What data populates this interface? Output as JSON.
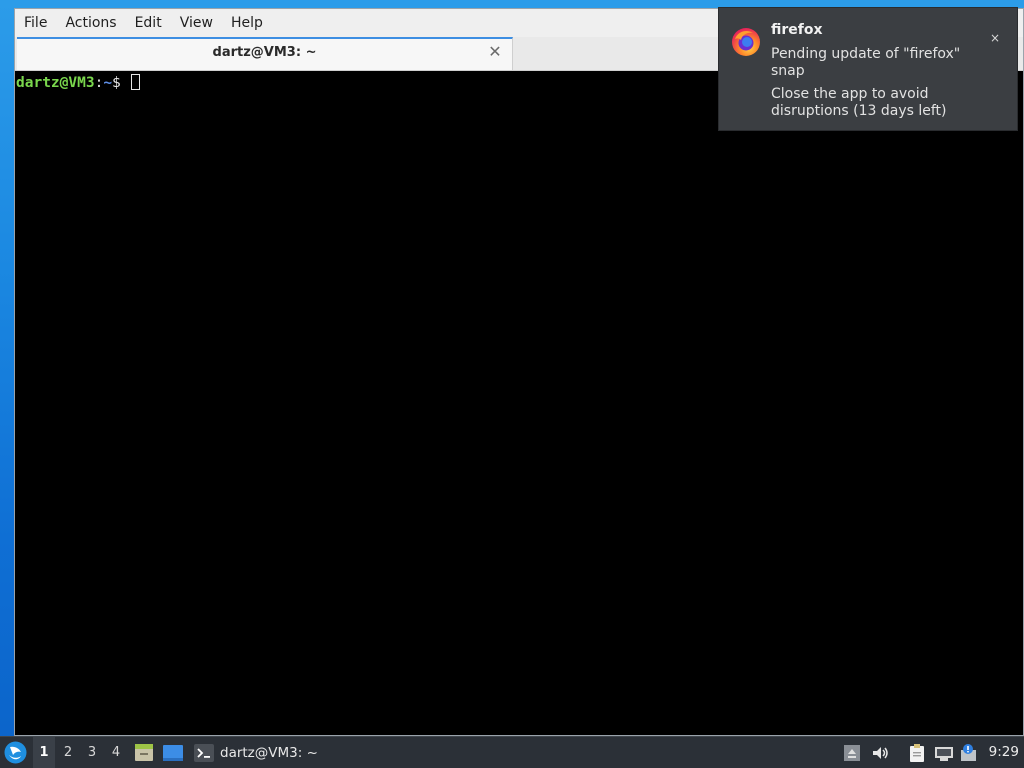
{
  "colors": {
    "desktop_top": "#2c9ce9",
    "desktop_bottom": "#0b63c9",
    "taskbar_bg": "#2b3037",
    "notification_bg": "#3b3e42",
    "prompt_user": "#7ad74d",
    "prompt_path": "#5f8fe8",
    "tab_accent": "#3d8ee2"
  },
  "terminal": {
    "menu": [
      "File",
      "Actions",
      "Edit",
      "View",
      "Help"
    ],
    "tab": {
      "title": "dartz@VM3: ~",
      "close_glyph": "✕"
    },
    "prompt": {
      "user_host": "dartz@VM3",
      "separator": ":",
      "path": "~",
      "symbol": "$ "
    }
  },
  "notification": {
    "app": "firefox",
    "icon": "firefox-icon",
    "message_line1": "Pending update of \"firefox\" snap",
    "message_line2": "Close the app to avoid disruptions (13 days left)",
    "close_glyph": "×"
  },
  "taskbar": {
    "start_icon": "lubuntu-logo-icon",
    "desktops": [
      "1",
      "2",
      "3",
      "4"
    ],
    "active_desktop": "1",
    "launchers": [
      {
        "icon": "file-manager-icon"
      },
      {
        "icon": "show-desktop-icon"
      }
    ],
    "task": {
      "icon": "terminal-icon",
      "label": "dartz@VM3: ~"
    },
    "tray": [
      {
        "icon": "eject-icon"
      },
      {
        "icon": "volume-icon"
      },
      {
        "icon": "clipboard-icon"
      },
      {
        "icon": "network-icon"
      },
      {
        "icon": "update-notifier-icon"
      }
    ],
    "clock": "9:29"
  }
}
